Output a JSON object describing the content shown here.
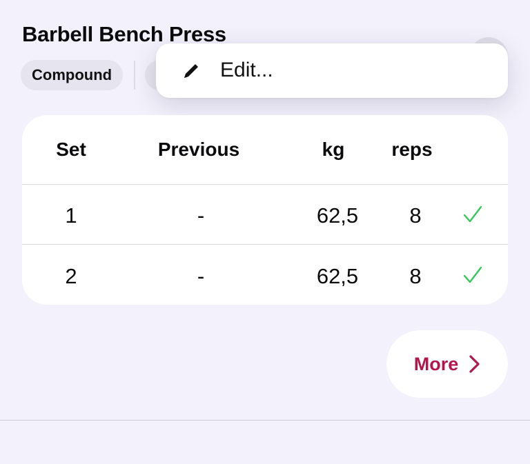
{
  "exercise": {
    "title": "Barbell Bench Press",
    "tag": "Compound"
  },
  "menu": {
    "edit_label": "Edit...",
    "edit_icon": "pencil-icon"
  },
  "table": {
    "headers": {
      "set": "Set",
      "previous": "Previous",
      "kg": "kg",
      "reps": "reps"
    },
    "rows": [
      {
        "set": "1",
        "previous": "-",
        "kg": "62,5",
        "reps": "8",
        "done": true
      },
      {
        "set": "2",
        "previous": "-",
        "kg": "62,5",
        "reps": "8",
        "done": true
      }
    ]
  },
  "more_button": {
    "label": "More",
    "icon": "chevron-right-icon"
  },
  "colors": {
    "accent": "#b3164a",
    "check": "#34c759",
    "background": "#f3f1fb"
  }
}
